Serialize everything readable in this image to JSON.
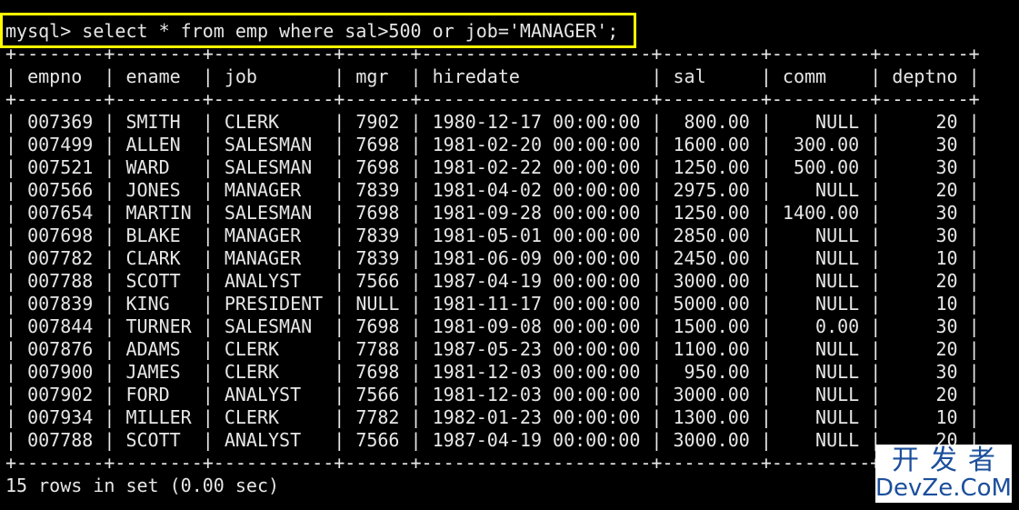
{
  "terminal": {
    "command": "mysql> select * from emp where sal>500 or job='MANAGER';",
    "border": "+--------+--------+-----------+------+---------------------+---------+---------+--------+",
    "header": "| empno  | ename  | job       | mgr  | hiredate            | sal     | comm    | deptno |",
    "rows": [
      "| 007369 | SMITH  | CLERK     | 7902 | 1980-12-17 00:00:00 |  800.00 |    NULL |     20 |",
      "| 007499 | ALLEN  | SALESMAN  | 7698 | 1981-02-20 00:00:00 | 1600.00 |  300.00 |     30 |",
      "| 007521 | WARD   | SALESMAN  | 7698 | 1981-02-22 00:00:00 | 1250.00 |  500.00 |     30 |",
      "| 007566 | JONES  | MANAGER   | 7839 | 1981-04-02 00:00:00 | 2975.00 |    NULL |     20 |",
      "| 007654 | MARTIN | SALESMAN  | 7698 | 1981-09-28 00:00:00 | 1250.00 | 1400.00 |     30 |",
      "| 007698 | BLAKE  | MANAGER   | 7839 | 1981-05-01 00:00:00 | 2850.00 |    NULL |     30 |",
      "| 007782 | CLARK  | MANAGER   | 7839 | 1981-06-09 00:00:00 | 2450.00 |    NULL |     10 |",
      "| 007788 | SCOTT  | ANALYST   | 7566 | 1987-04-19 00:00:00 | 3000.00 |    NULL |     20 |",
      "| 007839 | KING   | PRESIDENT | NULL | 1981-11-17 00:00:00 | 5000.00 |    NULL |     10 |",
      "| 007844 | TURNER | SALESMAN  | 7698 | 1981-09-08 00:00:00 | 1500.00 |    0.00 |     30 |",
      "| 007876 | ADAMS  | CLERK     | 7788 | 1987-05-23 00:00:00 | 1100.00 |    NULL |     20 |",
      "| 007900 | JAMES  | CLERK     | 7698 | 1981-12-03 00:00:00 |  950.00 |    NULL |     30 |",
      "| 007902 | FORD   | ANALYST   | 7566 | 1981-12-03 00:00:00 | 3000.00 |    NULL |     20 |",
      "| 007934 | MILLER | CLERK     | 7782 | 1982-01-23 00:00:00 | 1300.00 |    NULL |     10 |",
      "| 007788 | SCOTT  | ANALYST   | 7566 | 1987-04-19 00:00:00 | 3000.00 |    NULL |     20 |"
    ],
    "footer": "15 rows in set (0.00 sec)"
  },
  "watermark": {
    "line1": "开发者",
    "line2": "DevZe.CoM"
  },
  "colors": {
    "background": "#000000",
    "text": "#e6e6e6",
    "highlight": "#ffff00",
    "watermark": "#1c4f9c"
  }
}
